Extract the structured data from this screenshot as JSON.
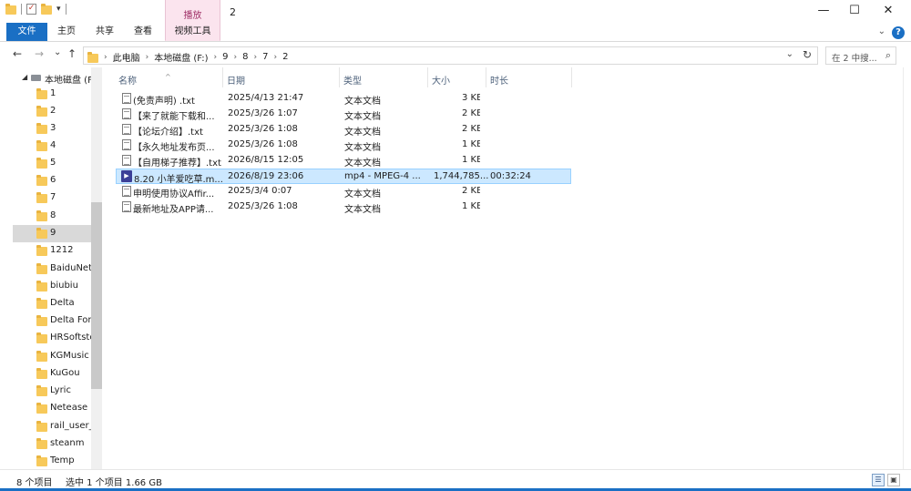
{
  "window": {
    "title": "2",
    "controls": {
      "minimize": "—",
      "maximize": "☐",
      "close": "✕"
    }
  },
  "ribbon": {
    "context_group": "播放",
    "tabs": [
      "文件",
      "主页",
      "共享",
      "查看",
      "视频工具"
    ],
    "help": "?"
  },
  "nav": {
    "back": "←",
    "forward": "→",
    "recent": "⌄",
    "up": "↑"
  },
  "address": {
    "crumbs": [
      "此电脑",
      "本地磁盘 (F:)",
      "9",
      "8",
      "7",
      "2"
    ]
  },
  "search": {
    "placeholder": "在 2 中搜..."
  },
  "sidebar": {
    "root": "本地磁盘 (F:)",
    "items": [
      "1",
      "2",
      "3",
      "4",
      "5",
      "6",
      "7",
      "8",
      "9",
      "1212",
      "BaiduNet",
      "biubiu",
      "Delta",
      "Delta Forc",
      "HRSoftsto",
      "KGMusic",
      "KuGou",
      "Lyric",
      "Netease",
      "rail_user_d",
      "steanm",
      "Temp"
    ],
    "selected": "9"
  },
  "columns": {
    "name": "名称",
    "date": "日期",
    "type": "类型",
    "size": "大小",
    "duration": "时长"
  },
  "files": [
    {
      "name": "(免责声明) .txt",
      "date": "2025/4/13 21:47",
      "type": "文本文档",
      "size": "3 KB",
      "duration": "",
      "icon": "text-doc-icon"
    },
    {
      "name": "【来了就能下载和...",
      "date": "2025/3/26 1:07",
      "type": "文本文档",
      "size": "2 KB",
      "duration": "",
      "icon": "text-doc-icon"
    },
    {
      "name": "【论坛介绍】.txt",
      "date": "2025/3/26 1:08",
      "type": "文本文档",
      "size": "2 KB",
      "duration": "",
      "icon": "text-doc-icon"
    },
    {
      "name": "【永久地址发布页...",
      "date": "2025/3/26 1:08",
      "type": "文本文档",
      "size": "1 KB",
      "duration": "",
      "icon": "text-doc-icon"
    },
    {
      "name": "【自用梯子推荐】.txt",
      "date": "2026/8/15 12:05",
      "type": "文本文档",
      "size": "1 KB",
      "duration": "",
      "icon": "text-doc-icon"
    },
    {
      "name": "8.20 小羊爱吃草.m...",
      "date": "2026/8/19 23:06",
      "type": "mp4 - MPEG-4 ...",
      "size": "1,744,785...",
      "duration": "00:32:24",
      "icon": "video-file-icon"
    },
    {
      "name": "申明使用协议Affir...",
      "date": "2025/3/4 0:07",
      "type": "文本文档",
      "size": "2 KB",
      "duration": "",
      "icon": "text-doc-icon"
    },
    {
      "name": "最新地址及APP请...",
      "date": "2025/3/26 1:08",
      "type": "文本文档",
      "size": "1 KB",
      "duration": "",
      "icon": "text-doc-icon"
    }
  ],
  "status": {
    "count": "8 个项目",
    "selection": "选中 1 个项目  1.66 GB"
  },
  "colors": {
    "accent": "#1a6fc4",
    "selection_bg": "#cce8ff",
    "context_tab": "#fbe4ee",
    "folder": "#f7c95a"
  }
}
